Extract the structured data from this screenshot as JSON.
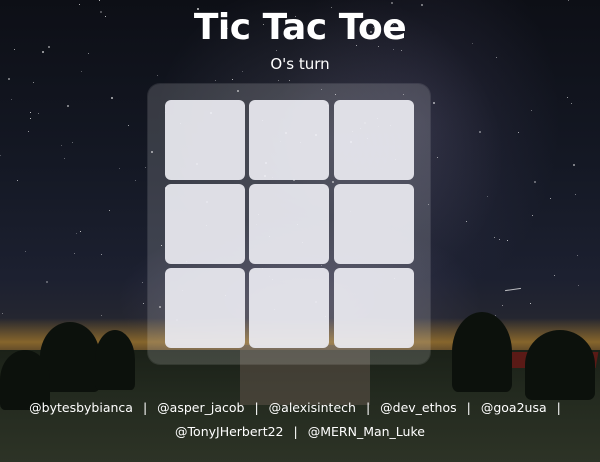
{
  "header": {
    "title": "Tic Tac Toe",
    "status": "O's turn"
  },
  "board": {
    "cells": [
      "",
      "",
      "",
      "",
      "",
      "",
      "",
      "",
      ""
    ]
  },
  "credits": {
    "line1": [
      "@bytesbybianca",
      "@asper_jacob",
      "@alexisintech",
      "@dev_ethos",
      "@goa2usa"
    ],
    "line2": [
      "@TonyJHerbert22",
      "@MERN_Man_Luke"
    ],
    "separator": "|"
  },
  "colors": {
    "text": "#ffffff",
    "cell": "#ececf2",
    "board_panel": "rgba(255,255,255,0.16)"
  }
}
